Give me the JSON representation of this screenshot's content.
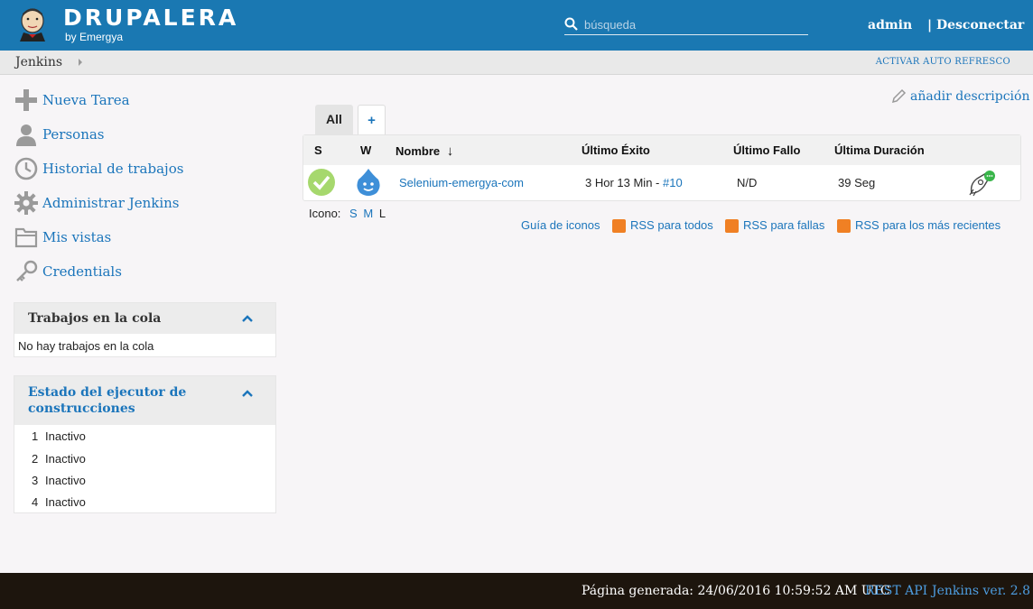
{
  "header": {
    "logo_title": "DRUPALERA",
    "logo_subtitle": "by Emergya",
    "search_placeholder": "búsqueda",
    "user": "admin",
    "logout": "| Desconectar"
  },
  "breadcrumb": {
    "item": "Jenkins",
    "auto_refresh": "ACTIVAR AUTO REFRESCO"
  },
  "sidebar": {
    "tasks": [
      {
        "label": "Nueva Tarea",
        "icon": "plus-icon"
      },
      {
        "label": "Personas",
        "icon": "person-icon"
      },
      {
        "label": "Historial de trabajos",
        "icon": "clock-icon"
      },
      {
        "label": "Administrar Jenkins",
        "icon": "gear-icon"
      },
      {
        "label": "Mis vistas",
        "icon": "folder-icon"
      },
      {
        "label": "Credentials",
        "icon": "key-icon"
      }
    ],
    "queue": {
      "title": "Trabajos en la cola",
      "empty": "No hay trabajos en la cola"
    },
    "executors": {
      "title_line1": "Estado del ejecutor de",
      "title_line2": "construcciones",
      "rows": [
        {
          "num": "1",
          "status": "Inactivo"
        },
        {
          "num": "2",
          "status": "Inactivo"
        },
        {
          "num": "3",
          "status": "Inactivo"
        },
        {
          "num": "4",
          "status": "Inactivo"
        }
      ]
    }
  },
  "main": {
    "add_description": "añadir descripción",
    "tabs": [
      {
        "label": "All"
      },
      {
        "label": "+"
      }
    ],
    "table": {
      "headers": {
        "s": "S",
        "w": "W",
        "name": "Nombre",
        "sort_arrow": "↓",
        "last_success": "Último Éxito",
        "last_failure": "Último Fallo",
        "last_duration": "Última Duración"
      },
      "rows": [
        {
          "name": "Selenium-emergya-com",
          "last_success": "3 Hor 13 Min - ",
          "last_success_build": "#10",
          "last_failure": "N/D",
          "last_duration": "39 Seg",
          "status_color": "#a6d86d",
          "weather_color": "#3e8fd8"
        }
      ]
    },
    "legend": {
      "label": "Icono:",
      "s": "S",
      "m": "M",
      "l": "L"
    },
    "feeds": {
      "icon_guide": "Guía de iconos",
      "rss_all": "RSS para todos",
      "rss_failures": "RSS para fallas",
      "rss_latest": "RSS para los más recientes"
    }
  },
  "footer": {
    "generated": "Página generada: 24/06/2016 10:59:52 AM UTC",
    "rest_api": "REST API",
    "version": "Jenkins ver. 2.8"
  },
  "colors": {
    "header_bg": "#1a78b2",
    "link": "#1b75bb",
    "footer_bg": "#1d150d",
    "rss": "#f08024"
  }
}
